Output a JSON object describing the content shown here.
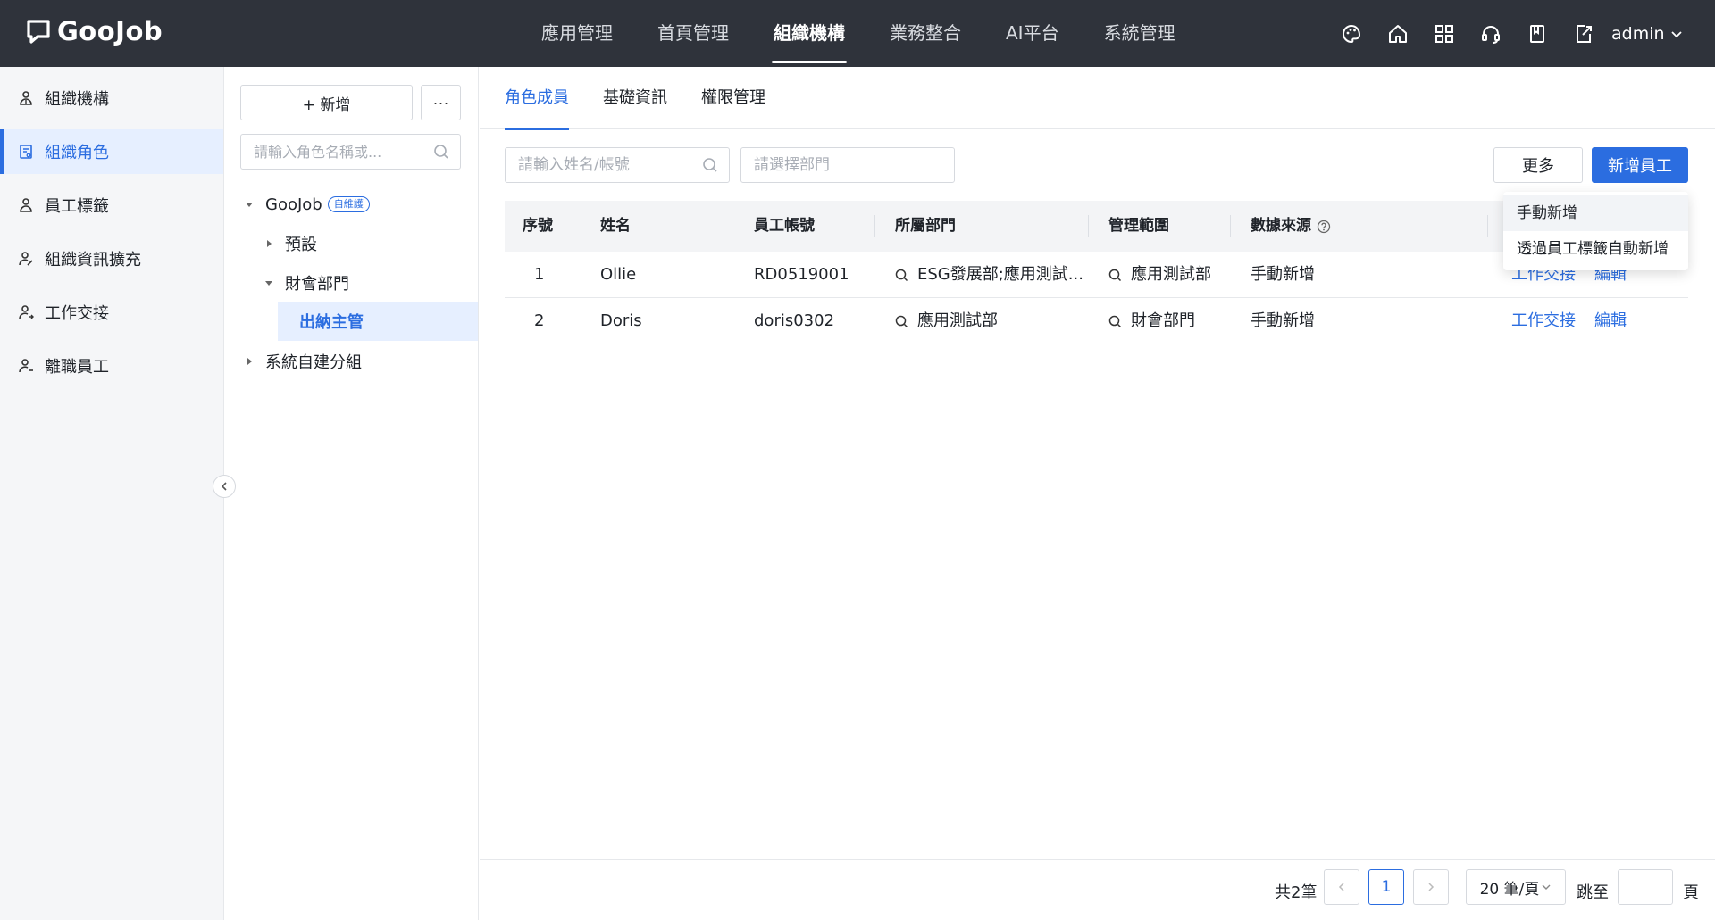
{
  "brand": {
    "name": "GooJob"
  },
  "topnav": {
    "items": [
      {
        "label": "應用管理"
      },
      {
        "label": "首頁管理"
      },
      {
        "label": "組織機構"
      },
      {
        "label": "業務整合"
      },
      {
        "label": "AI平台"
      },
      {
        "label": "系統管理"
      }
    ],
    "active_index": 2,
    "icons": [
      "palette-icon",
      "home-icon",
      "apps-grid-icon",
      "headset-icon",
      "book-icon",
      "export-icon"
    ],
    "user": "admin"
  },
  "sidebar": {
    "items": [
      {
        "label": "組織機構",
        "icon": "org-icon"
      },
      {
        "label": "組織角色",
        "icon": "role-icon",
        "active": true
      },
      {
        "label": "員工標籤",
        "icon": "tag-user-icon"
      },
      {
        "label": "組織資訊擴充",
        "icon": "user-edit-icon"
      },
      {
        "label": "工作交接",
        "icon": "handover-icon"
      },
      {
        "label": "離職員工",
        "icon": "resigned-icon"
      }
    ]
  },
  "tree": {
    "add_label": "+ 新增",
    "more_label": "···",
    "search_placeholder": "請輸入角色名稱或...",
    "nodes": [
      {
        "label": "GooJob",
        "badge": "自維護"
      },
      {
        "label": "預設"
      },
      {
        "label": "財會部門"
      },
      {
        "label": "出納主管"
      },
      {
        "label": "系統自建分組"
      }
    ]
  },
  "tabs": [
    {
      "label": "角色成員"
    },
    {
      "label": "基礎資訊"
    },
    {
      "label": "權限管理"
    }
  ],
  "filters": {
    "name_placeholder": "請輸入姓名/帳號",
    "dept_placeholder": "請選擇部門"
  },
  "actions": {
    "more_label": "更多",
    "add_label": "新增員工"
  },
  "dropdown": {
    "items": [
      {
        "label": "手動新增"
      },
      {
        "label": "透過員工標籤自動新增"
      }
    ]
  },
  "table": {
    "headers": {
      "seq": "序號",
      "name": "姓名",
      "account": "員工帳號",
      "dept": "所屬部門",
      "scope": "管理範圍",
      "source": "數據來源"
    },
    "rows": [
      {
        "seq": "1",
        "name": "Ollie",
        "account": "RD0519001",
        "dept": "ESG發展部;應用測試...",
        "scope": "應用測試部",
        "source": "手動新增",
        "handover": "工作交接",
        "edit": "編輯"
      },
      {
        "seq": "2",
        "name": "Doris",
        "account": "doris0302",
        "dept": "應用測試部",
        "scope": "財會部門",
        "source": "手動新增",
        "handover": "工作交接",
        "edit": "編輯"
      }
    ]
  },
  "pagination": {
    "total": "共2筆",
    "current_page": "1",
    "page_size": "20 筆/頁",
    "jump_label": "跳至",
    "page_label": "頁"
  },
  "colors": {
    "topbar": "#2f333b",
    "accent": "#2b6de0"
  }
}
